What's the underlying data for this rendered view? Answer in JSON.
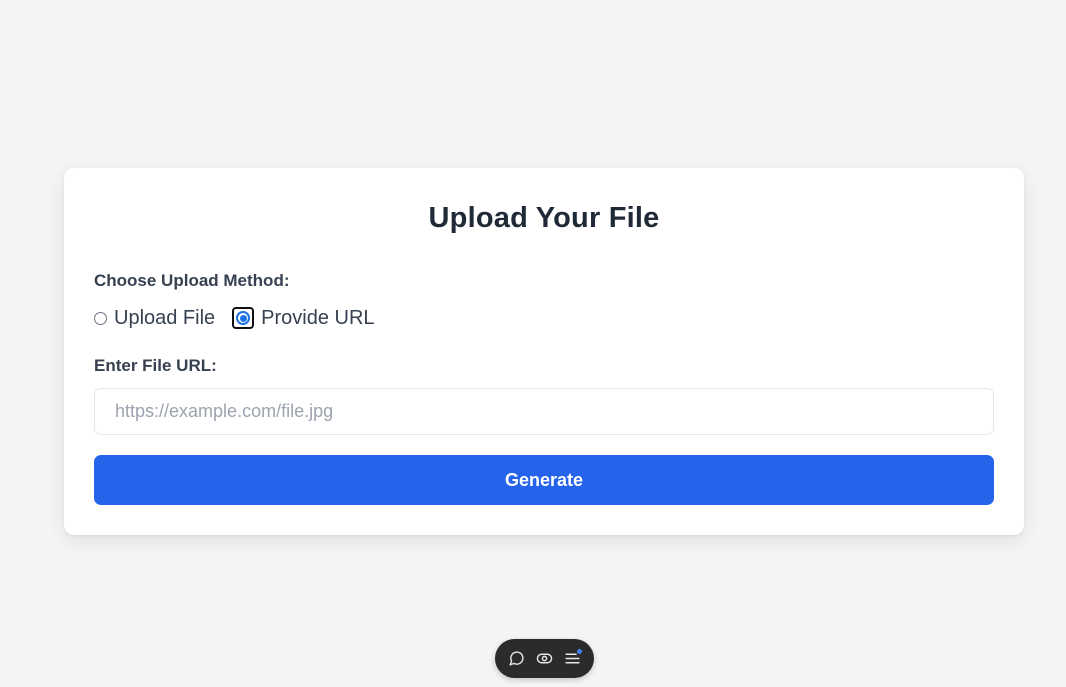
{
  "form": {
    "title": "Upload Your File",
    "method_label": "Choose Upload Method:",
    "options": [
      {
        "label": "Upload File",
        "selected": false
      },
      {
        "label": "Provide URL",
        "selected": true
      }
    ],
    "url_label": "Enter File URL:",
    "url_value": "",
    "url_placeholder": "https://example.com/file.jpg",
    "submit_label": "Generate"
  },
  "toolbar": {
    "icons": [
      "comment-icon",
      "eye-icon",
      "menu-icon"
    ]
  },
  "colors": {
    "accent": "#2563eb",
    "background": "#f3f4f6",
    "radio_checked": "#1a73e8"
  }
}
